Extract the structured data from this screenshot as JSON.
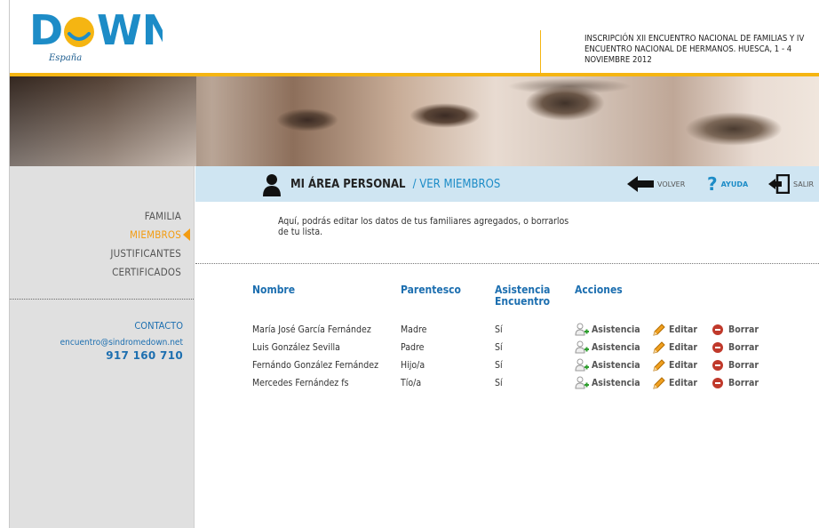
{
  "header": {
    "logo_text": "DOWN",
    "logo_sub": "España",
    "event_title": "INSCRIPCIÓN XII ENCUENTRO NACIONAL DE FAMILIAS Y IV ENCUENTRO NACIONAL DE HERMANOS. HUESCA, 1 - 4 NOVIEMBRE 2012"
  },
  "sidebar": {
    "items": [
      {
        "label": "FAMILIA"
      },
      {
        "label": "MIEMBROS"
      },
      {
        "label": "JUSTIFICANTES"
      },
      {
        "label": "CERTIFICADOS"
      }
    ],
    "active_item": "MIEMBROS",
    "contact": {
      "title": "CONTACTO",
      "email": "encuentro@sindromedown.net",
      "phone": "917 160 710"
    }
  },
  "topbar": {
    "title": "MI ÁREA PERSONAL",
    "subtitle": "/ VER MIEMBROS",
    "volver": "VOLVER",
    "ayuda": "AYUDA",
    "salir": "SALIR"
  },
  "intro": "Aquí, podrás editar los datos de tus familiares agregados, o borrarlos de tu lista.",
  "table": {
    "headers": {
      "nombre": "Nombre",
      "parentesco": "Parentesco",
      "asistencia": "Asistencia Encuentro",
      "acciones": "Acciones"
    },
    "rows": [
      {
        "nombre": "María José García Fernández",
        "parentesco": "Madre",
        "asistencia": "Sí"
      },
      {
        "nombre": "Luis González Sevilla",
        "parentesco": "Padre",
        "asistencia": "Sí"
      },
      {
        "nombre": "Fernándo González Fernández",
        "parentesco": "Hijo/a",
        "asistencia": "Sí"
      },
      {
        "nombre": "Mercedes Fernández fs",
        "parentesco": "Tío/a",
        "asistencia": "Sí"
      }
    ],
    "actions": {
      "asistencia": "Asistencia",
      "editar": "Editar",
      "borrar": "Borrar"
    }
  },
  "colors": {
    "accent_blue": "#1d8cc7",
    "accent_orange": "#f39c12",
    "header_line": "#f5b512",
    "topbar_bg": "#cfe5f2",
    "sidebar_bg": "#e0e0e0",
    "delete_red": "#c0392b"
  },
  "icons": [
    "person-icon",
    "arrow-left-icon",
    "help-icon",
    "exit-icon",
    "user-add-icon",
    "pencil-icon",
    "delete-icon"
  ]
}
